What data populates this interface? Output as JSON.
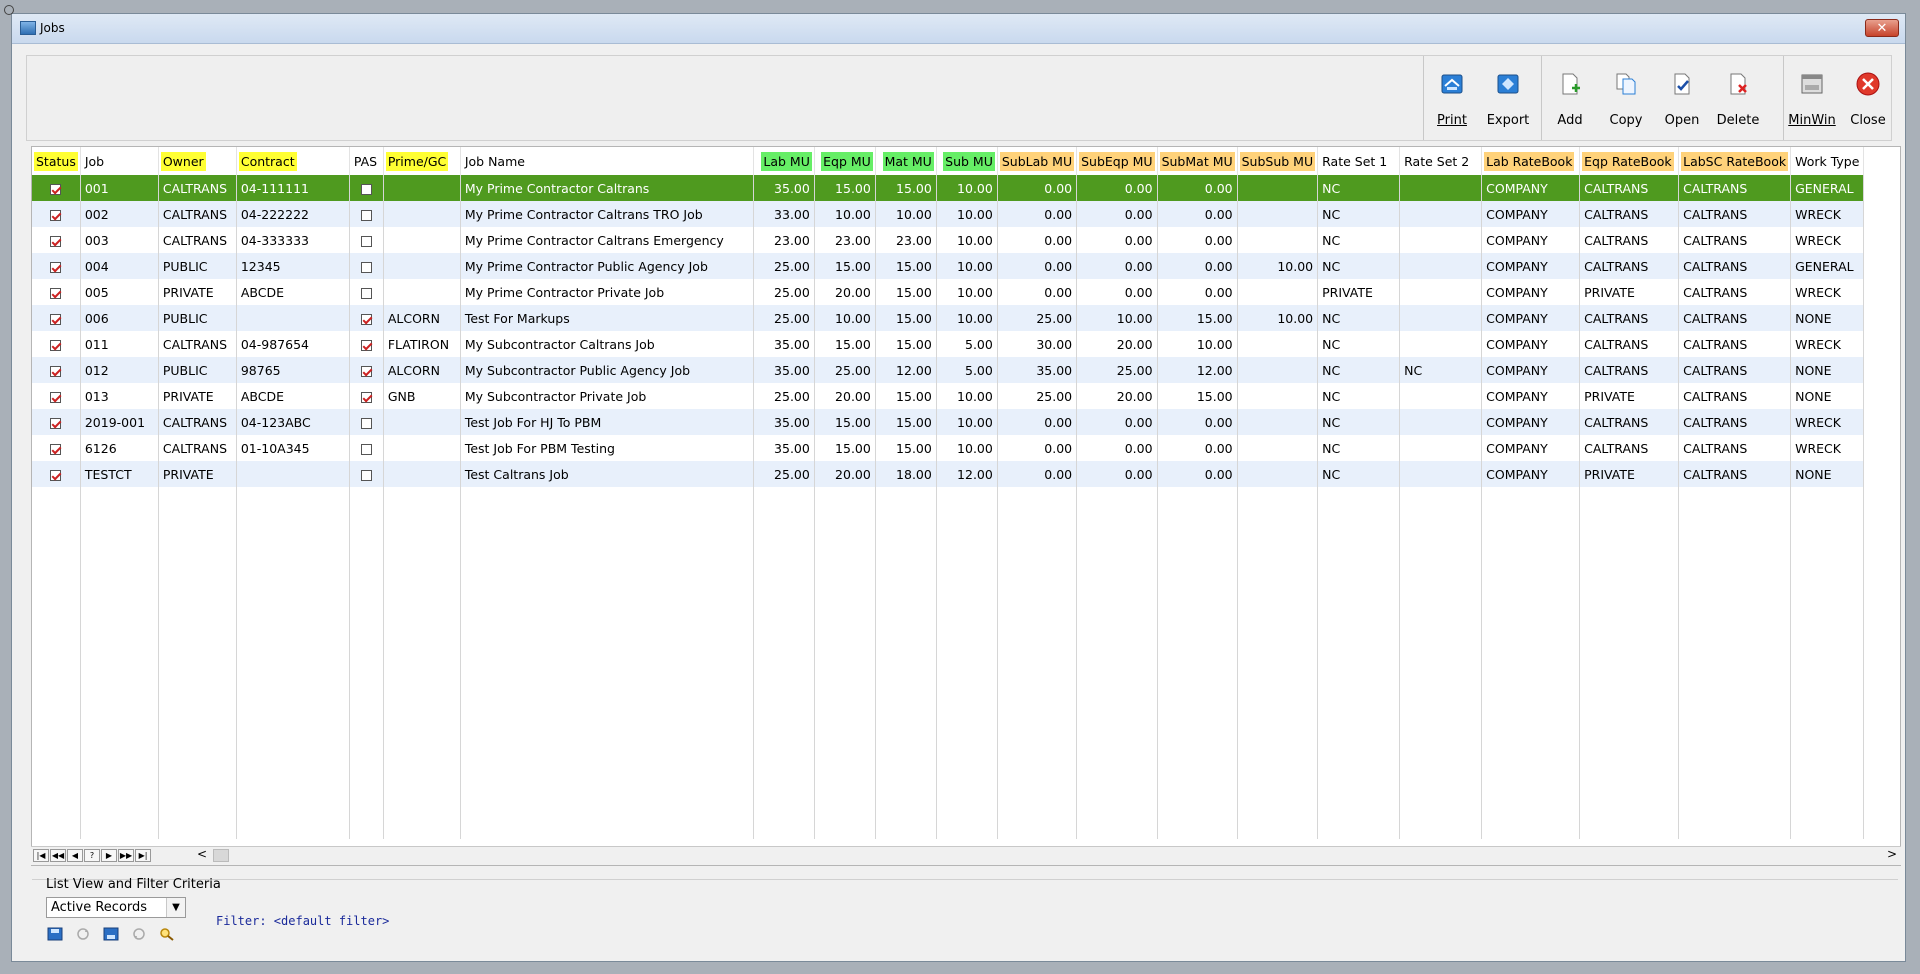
{
  "window": {
    "title": "Jobs",
    "close_label": "✕"
  },
  "toolbar": {
    "print": "Print",
    "export": "Export",
    "add": "Add",
    "copy": "Copy",
    "open": "Open",
    "delete": "Delete",
    "minwin": "MinWin",
    "close": "Close"
  },
  "columns": {
    "status": "Status",
    "job": "Job",
    "owner": "Owner",
    "contract": "Contract",
    "pas": "PAS",
    "prime_gc": "Prime/GC",
    "job_name": "Job Name",
    "lab_mu": "Lab MU",
    "eqp_mu": "Eqp MU",
    "mat_mu": "Mat MU",
    "sub_mu": "Sub MU",
    "sublab_mu": "SubLab MU",
    "subeqp_mu": "SubEqp MU",
    "submat_mu": "SubMat MU",
    "subsub_mu": "SubSub MU",
    "rate_set_1": "Rate Set 1",
    "rate_set_2": "Rate Set 2",
    "lab_ratebook": "Lab RateBook",
    "eqp_ratebook": "Eqp RateBook",
    "labsc_ratebook": "LabSC RateBook",
    "work_type": "Work Type"
  },
  "rows": [
    {
      "status": true,
      "job": "001",
      "owner": "CALTRANS",
      "contract": "04-111111",
      "pas": false,
      "prime": "",
      "name": "My Prime Contractor Caltrans",
      "lab": "35.00",
      "eqp": "15.00",
      "mat": "15.00",
      "sub": "10.00",
      "sublab": "0.00",
      "subeqp": "0.00",
      "submat": "0.00",
      "subsub": "",
      "rs1": "NC",
      "rs2": "",
      "labrb": "COMPANY",
      "eqprb": "CALTRANS",
      "labscrb": "CALTRANS",
      "wt": "GENERAL"
    },
    {
      "status": true,
      "job": "002",
      "owner": "CALTRANS",
      "contract": "04-222222",
      "pas": false,
      "prime": "",
      "name": "My Prime Contractor Caltrans TRO Job",
      "lab": "33.00",
      "eqp": "10.00",
      "mat": "10.00",
      "sub": "10.00",
      "sublab": "0.00",
      "subeqp": "0.00",
      "submat": "0.00",
      "subsub": "",
      "rs1": "NC",
      "rs2": "",
      "labrb": "COMPANY",
      "eqprb": "CALTRANS",
      "labscrb": "CALTRANS",
      "wt": "WRECK"
    },
    {
      "status": true,
      "job": "003",
      "owner": "CALTRANS",
      "contract": "04-333333",
      "pas": false,
      "prime": "",
      "name": "My Prime Contractor Caltrans Emergency",
      "lab": "23.00",
      "eqp": "23.00",
      "mat": "23.00",
      "sub": "10.00",
      "sublab": "0.00",
      "subeqp": "0.00",
      "submat": "0.00",
      "subsub": "",
      "rs1": "NC",
      "rs2": "",
      "labrb": "COMPANY",
      "eqprb": "CALTRANS",
      "labscrb": "CALTRANS",
      "wt": "WRECK"
    },
    {
      "status": true,
      "job": "004",
      "owner": "PUBLIC",
      "contract": "12345",
      "pas": false,
      "prime": "",
      "name": "My Prime Contractor Public Agency Job",
      "lab": "25.00",
      "eqp": "15.00",
      "mat": "15.00",
      "sub": "10.00",
      "sublab": "0.00",
      "subeqp": "0.00",
      "submat": "0.00",
      "subsub": "10.00",
      "rs1": "NC",
      "rs2": "",
      "labrb": "COMPANY",
      "eqprb": "CALTRANS",
      "labscrb": "CALTRANS",
      "wt": "GENERAL"
    },
    {
      "status": true,
      "job": "005",
      "owner": "PRIVATE",
      "contract": "ABCDE",
      "pas": false,
      "prime": "",
      "name": "My Prime Contractor Private Job",
      "lab": "25.00",
      "eqp": "20.00",
      "mat": "15.00",
      "sub": "10.00",
      "sublab": "0.00",
      "subeqp": "0.00",
      "submat": "0.00",
      "subsub": "",
      "rs1": "PRIVATE",
      "rs2": "",
      "labrb": "COMPANY",
      "eqprb": "PRIVATE",
      "labscrb": "CALTRANS",
      "wt": "WRECK"
    },
    {
      "status": true,
      "job": "006",
      "owner": "PUBLIC",
      "contract": "",
      "pas": true,
      "prime": "ALCORN",
      "name": "Test For Markups",
      "lab": "25.00",
      "eqp": "10.00",
      "mat": "15.00",
      "sub": "10.00",
      "sublab": "25.00",
      "subeqp": "10.00",
      "submat": "15.00",
      "subsub": "10.00",
      "rs1": "NC",
      "rs2": "",
      "labrb": "COMPANY",
      "eqprb": "CALTRANS",
      "labscrb": "CALTRANS",
      "wt": "NONE"
    },
    {
      "status": true,
      "job": "011",
      "owner": "CALTRANS",
      "contract": "04-987654",
      "pas": true,
      "prime": "FLATIRON",
      "name": "My Subcontractor Caltrans Job",
      "lab": "35.00",
      "eqp": "15.00",
      "mat": "15.00",
      "sub": "5.00",
      "sublab": "30.00",
      "subeqp": "20.00",
      "submat": "10.00",
      "subsub": "",
      "rs1": "NC",
      "rs2": "",
      "labrb": "COMPANY",
      "eqprb": "CALTRANS",
      "labscrb": "CALTRANS",
      "wt": "WRECK"
    },
    {
      "status": true,
      "job": "012",
      "owner": "PUBLIC",
      "contract": "98765",
      "pas": true,
      "prime": "ALCORN",
      "name": "My Subcontractor Public Agency Job",
      "lab": "35.00",
      "eqp": "25.00",
      "mat": "12.00",
      "sub": "5.00",
      "sublab": "35.00",
      "subeqp": "25.00",
      "submat": "12.00",
      "subsub": "",
      "rs1": "NC",
      "rs2": "NC",
      "labrb": "COMPANY",
      "eqprb": "CALTRANS",
      "labscrb": "CALTRANS",
      "wt": "NONE"
    },
    {
      "status": true,
      "job": "013",
      "owner": "PRIVATE",
      "contract": "ABCDE",
      "pas": true,
      "prime": "GNB",
      "name": "My Subcontractor Private Job",
      "lab": "25.00",
      "eqp": "20.00",
      "mat": "15.00",
      "sub": "10.00",
      "sublab": "25.00",
      "subeqp": "20.00",
      "submat": "15.00",
      "subsub": "",
      "rs1": "NC",
      "rs2": "",
      "labrb": "COMPANY",
      "eqprb": "PRIVATE",
      "labscrb": "CALTRANS",
      "wt": "NONE"
    },
    {
      "status": true,
      "job": "2019-001",
      "owner": "CALTRANS",
      "contract": "04-123ABC",
      "pas": false,
      "prime": "",
      "name": "Test Job For HJ To PBM",
      "lab": "35.00",
      "eqp": "15.00",
      "mat": "15.00",
      "sub": "10.00",
      "sublab": "0.00",
      "subeqp": "0.00",
      "submat": "0.00",
      "subsub": "",
      "rs1": "NC",
      "rs2": "",
      "labrb": "COMPANY",
      "eqprb": "CALTRANS",
      "labscrb": "CALTRANS",
      "wt": "WRECK"
    },
    {
      "status": true,
      "job": "6126",
      "owner": "CALTRANS",
      "contract": "01-10A345",
      "pas": false,
      "prime": "",
      "name": "Test Job For PBM Testing",
      "lab": "35.00",
      "eqp": "15.00",
      "mat": "15.00",
      "sub": "10.00",
      "sublab": "0.00",
      "subeqp": "0.00",
      "submat": "0.00",
      "subsub": "",
      "rs1": "NC",
      "rs2": "",
      "labrb": "COMPANY",
      "eqprb": "CALTRANS",
      "labscrb": "CALTRANS",
      "wt": "WRECK"
    },
    {
      "status": true,
      "job": "TESTCT",
      "owner": "PRIVATE",
      "contract": "",
      "pas": false,
      "prime": "",
      "name": "Test Caltrans Job",
      "lab": "25.00",
      "eqp": "20.00",
      "mat": "18.00",
      "sub": "12.00",
      "sublab": "0.00",
      "subeqp": "0.00",
      "submat": "0.00",
      "subsub": "",
      "rs1": "NC",
      "rs2": "",
      "labrb": "COMPANY",
      "eqprb": "PRIVATE",
      "labscrb": "CALTRANS",
      "wt": "NONE"
    }
  ],
  "navigator": {
    "first": "|◀",
    "prev_page": "◀◀",
    "prev": "◀",
    "help": "?",
    "next": "▶",
    "next_page": "▶▶",
    "last": "▶|",
    "scroll_left": "<",
    "scroll_right": ">"
  },
  "filter_panel": {
    "title": "List View and Filter Criteria",
    "view_selected": "Active Records",
    "filter_text": "Filter: <default filter>"
  },
  "colors": {
    "selected_row": "#4f9a1f",
    "alt_row": "#e8f0fb",
    "hl_yellow": "#ffff33",
    "hl_green": "#66ee66",
    "hl_orange": "#ffd27a"
  }
}
